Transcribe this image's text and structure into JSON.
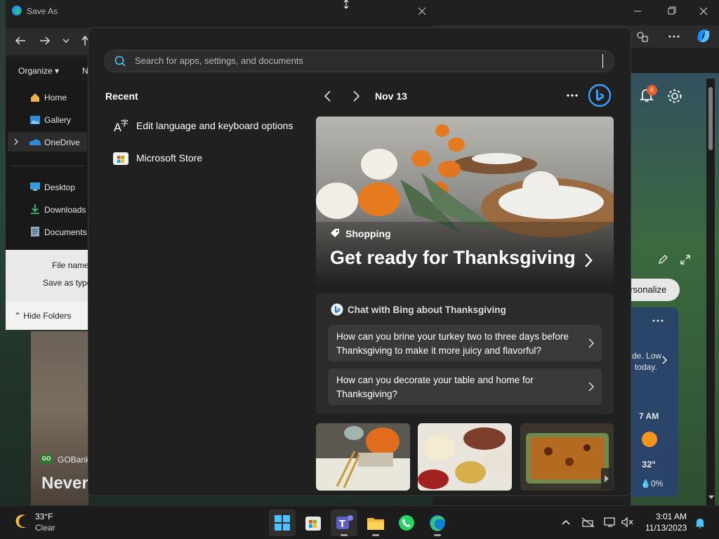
{
  "explorer": {
    "title": "Save As",
    "command_organize": "Organize",
    "command_new": "N",
    "sidebar": [
      {
        "label": "Home"
      },
      {
        "label": "Gallery"
      },
      {
        "label": "OneDrive"
      },
      {
        "label": "Desktop"
      },
      {
        "label": "Downloads"
      },
      {
        "label": "Documents"
      }
    ],
    "file_name_label": "File name",
    "save_as_type_label": "Save as type",
    "hide_folders": "Hide Folders"
  },
  "edge": {
    "notification_count": "6",
    "personalize_label": "ersonalize",
    "weather_text_1": "de. Low",
    "weather_text_2": "today.",
    "weather_hour": "7 AM",
    "weather_temp": "32°",
    "weather_precip": "0%",
    "news_source": "GOBank",
    "news_headline": "Never"
  },
  "start": {
    "search_placeholder": "Search for apps, settings, and documents",
    "recent_title": "Recent",
    "recent": [
      {
        "label": "Edit language and keyboard options",
        "icon": "language-icon"
      },
      {
        "label": "Microsoft Store",
        "icon": "store-icon"
      }
    ],
    "date": "Nov 13",
    "hero": {
      "category": "Shopping",
      "title": "Get ready for Thanksgiving"
    },
    "chat": {
      "title": "Chat with Bing about Thanksgiving",
      "questions": [
        "How can you brine your turkey two to three days before Thanksgiving to make it more juicy and flavorful?",
        "How can you decorate your table and home for Thanksgiving?"
      ]
    },
    "thumbnails": [
      "thankful-table-image",
      "food-spread-image",
      "casserole-image"
    ]
  },
  "taskbar": {
    "weather_temp": "33°F",
    "weather_desc": "Clear",
    "time": "3:01 AM",
    "date": "11/13/2023",
    "apps": [
      "start-icon",
      "microsoft-store-icon",
      "teams-icon",
      "file-explorer-icon",
      "whatsapp-icon",
      "edge-icon"
    ]
  },
  "colors": {
    "accent": "#0078d4",
    "start_bg": "#202020",
    "taskbar_bg": "#1c1c1c",
    "notification_badge": "#e65c2b"
  }
}
